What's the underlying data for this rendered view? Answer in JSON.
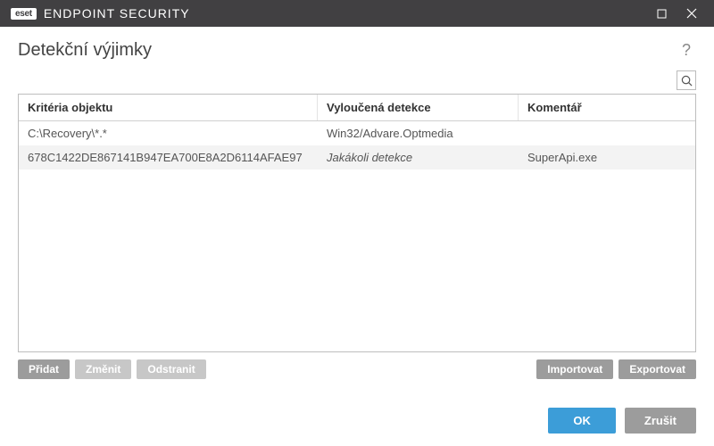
{
  "titlebar": {
    "brand_box": "eset",
    "brand_text": "ENDPOINT SECURITY"
  },
  "header": {
    "title": "Detekční výjimky",
    "help": "?"
  },
  "table": {
    "headers": {
      "col1": "Kritéria objektu",
      "col2": "Vyloučená detekce",
      "col3": "Komentář"
    },
    "rows": [
      {
        "c1": "C:\\Recovery\\*.*",
        "c2": "Win32/Advare.Optmedia",
        "c3": "",
        "c2_italic": false
      },
      {
        "c1": "678C1422DE867141B947EA700E8A2D6114AFAE97",
        "c2": "Jakákoli detekce",
        "c3": "SuperApi.exe",
        "c2_italic": true
      }
    ]
  },
  "actions": {
    "add": "Přidat",
    "edit": "Změnit",
    "remove": "Odstranit",
    "import": "Importovat",
    "export": "Exportovat"
  },
  "footer": {
    "ok": "OK",
    "cancel": "Zrušit"
  }
}
